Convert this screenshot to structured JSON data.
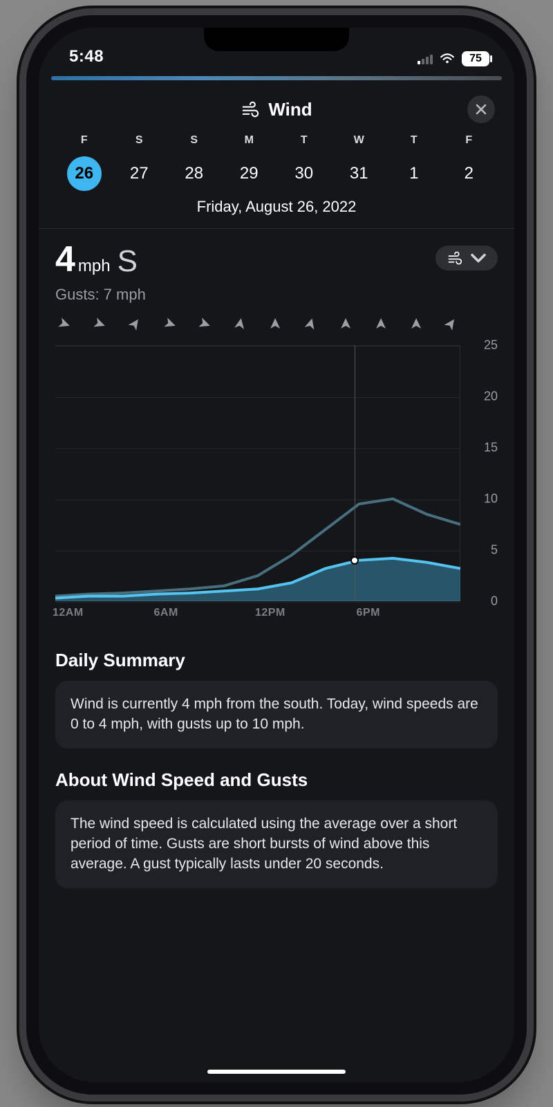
{
  "status_bar": {
    "time": "5:48",
    "battery": "75"
  },
  "header": {
    "title": "Wind"
  },
  "days": [
    {
      "letter": "F",
      "num": "26",
      "selected": true
    },
    {
      "letter": "S",
      "num": "27",
      "selected": false
    },
    {
      "letter": "S",
      "num": "28",
      "selected": false
    },
    {
      "letter": "M",
      "num": "29",
      "selected": false
    },
    {
      "letter": "T",
      "num": "30",
      "selected": false
    },
    {
      "letter": "W",
      "num": "31",
      "selected": false
    },
    {
      "letter": "T",
      "num": "1",
      "selected": false
    },
    {
      "letter": "F",
      "num": "2",
      "selected": false
    }
  ],
  "full_date": "Friday, August 26, 2022",
  "readout": {
    "value": "4",
    "unit": "mph",
    "direction": "S",
    "gusts_label": "Gusts: 7 mph"
  },
  "chart_data": {
    "type": "line",
    "x": [
      0,
      2,
      4,
      6,
      8,
      10,
      12,
      14,
      16,
      18,
      20,
      22,
      24
    ],
    "series": [
      {
        "name": "wind",
        "values": [
          0.3,
          0.5,
          0.5,
          0.7,
          0.8,
          1.0,
          1.2,
          1.8,
          3.2,
          4.0,
          4.2,
          3.8,
          3.2
        ]
      },
      {
        "name": "gusts",
        "values": [
          0.5,
          0.7,
          0.8,
          1.0,
          1.2,
          1.5,
          2.5,
          4.5,
          7.0,
          9.5,
          10.0,
          8.5,
          7.5
        ]
      }
    ],
    "x_ticks": [
      "12AM",
      "6AM",
      "12PM",
      "6PM"
    ],
    "y_ticks": [
      0,
      5,
      10,
      15,
      20,
      25
    ],
    "ylim": [
      0,
      25
    ],
    "xlim": [
      0,
      24
    ],
    "now_x": 17.75,
    "now_y": 4.0,
    "direction_arrows_deg": [
      110,
      110,
      35,
      110,
      110,
      10,
      0,
      15,
      0,
      0,
      0,
      35
    ],
    "xlabel": "",
    "ylabel": "",
    "title": ""
  },
  "summary": {
    "title": "Daily Summary",
    "body": "Wind is currently 4 mph from the south. Today, wind speeds are 0 to 4 mph, with gusts up to 10 mph."
  },
  "about": {
    "title": "About Wind Speed and Gusts",
    "body": "The wind speed is calculated using the average over a short period of time. Gusts are short bursts of wind above this average. A gust typically lasts under 20 seconds."
  },
  "colors": {
    "accent": "#3fb6ef",
    "wind_line": "#55c3f0",
    "wind_fill": "rgba(64,162,203,0.45)",
    "gust_line": "#486f7f"
  }
}
